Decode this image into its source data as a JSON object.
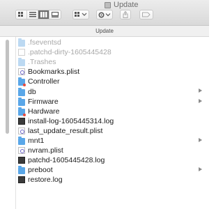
{
  "window": {
    "title": "Update"
  },
  "pathbar": {
    "label": "Update"
  },
  "toolbar": {
    "view_modes": [
      "icon-view",
      "list-view",
      "column-view",
      "gallery-view"
    ],
    "selected_view": "column-view",
    "buttons": [
      "group-menu",
      "action-menu",
      "share",
      "tag"
    ]
  },
  "files": [
    {
      "name": ".fseventsd",
      "kind": "folder",
      "hidden": true,
      "expandable": false
    },
    {
      "name": ".patchd-dirty-1605445428",
      "kind": "file",
      "hidden": true,
      "expandable": false
    },
    {
      "name": ".Trashes",
      "kind": "folder",
      "hidden": true,
      "expandable": false
    },
    {
      "name": "Bookmarks.plist",
      "kind": "plist",
      "hidden": false,
      "expandable": false
    },
    {
      "name": "Controller",
      "kind": "folder-badge",
      "hidden": false,
      "expandable": false
    },
    {
      "name": "db",
      "kind": "folder",
      "hidden": false,
      "expandable": true
    },
    {
      "name": "Firmware",
      "kind": "folder",
      "hidden": false,
      "expandable": true
    },
    {
      "name": "Hardware",
      "kind": "folder-badge",
      "hidden": false,
      "expandable": false
    },
    {
      "name": "install-log-1605445314.log",
      "kind": "log",
      "hidden": false,
      "expandable": false
    },
    {
      "name": "last_update_result.plist",
      "kind": "plist",
      "hidden": false,
      "expandable": false
    },
    {
      "name": "mnt1",
      "kind": "folder",
      "hidden": false,
      "expandable": true
    },
    {
      "name": "nvram.plist",
      "kind": "plist",
      "hidden": false,
      "expandable": false
    },
    {
      "name": "patchd-1605445428.log",
      "kind": "log",
      "hidden": false,
      "expandable": false
    },
    {
      "name": "preboot",
      "kind": "folder",
      "hidden": false,
      "expandable": true
    },
    {
      "name": "restore.log",
      "kind": "log",
      "hidden": false,
      "expandable": false
    }
  ]
}
